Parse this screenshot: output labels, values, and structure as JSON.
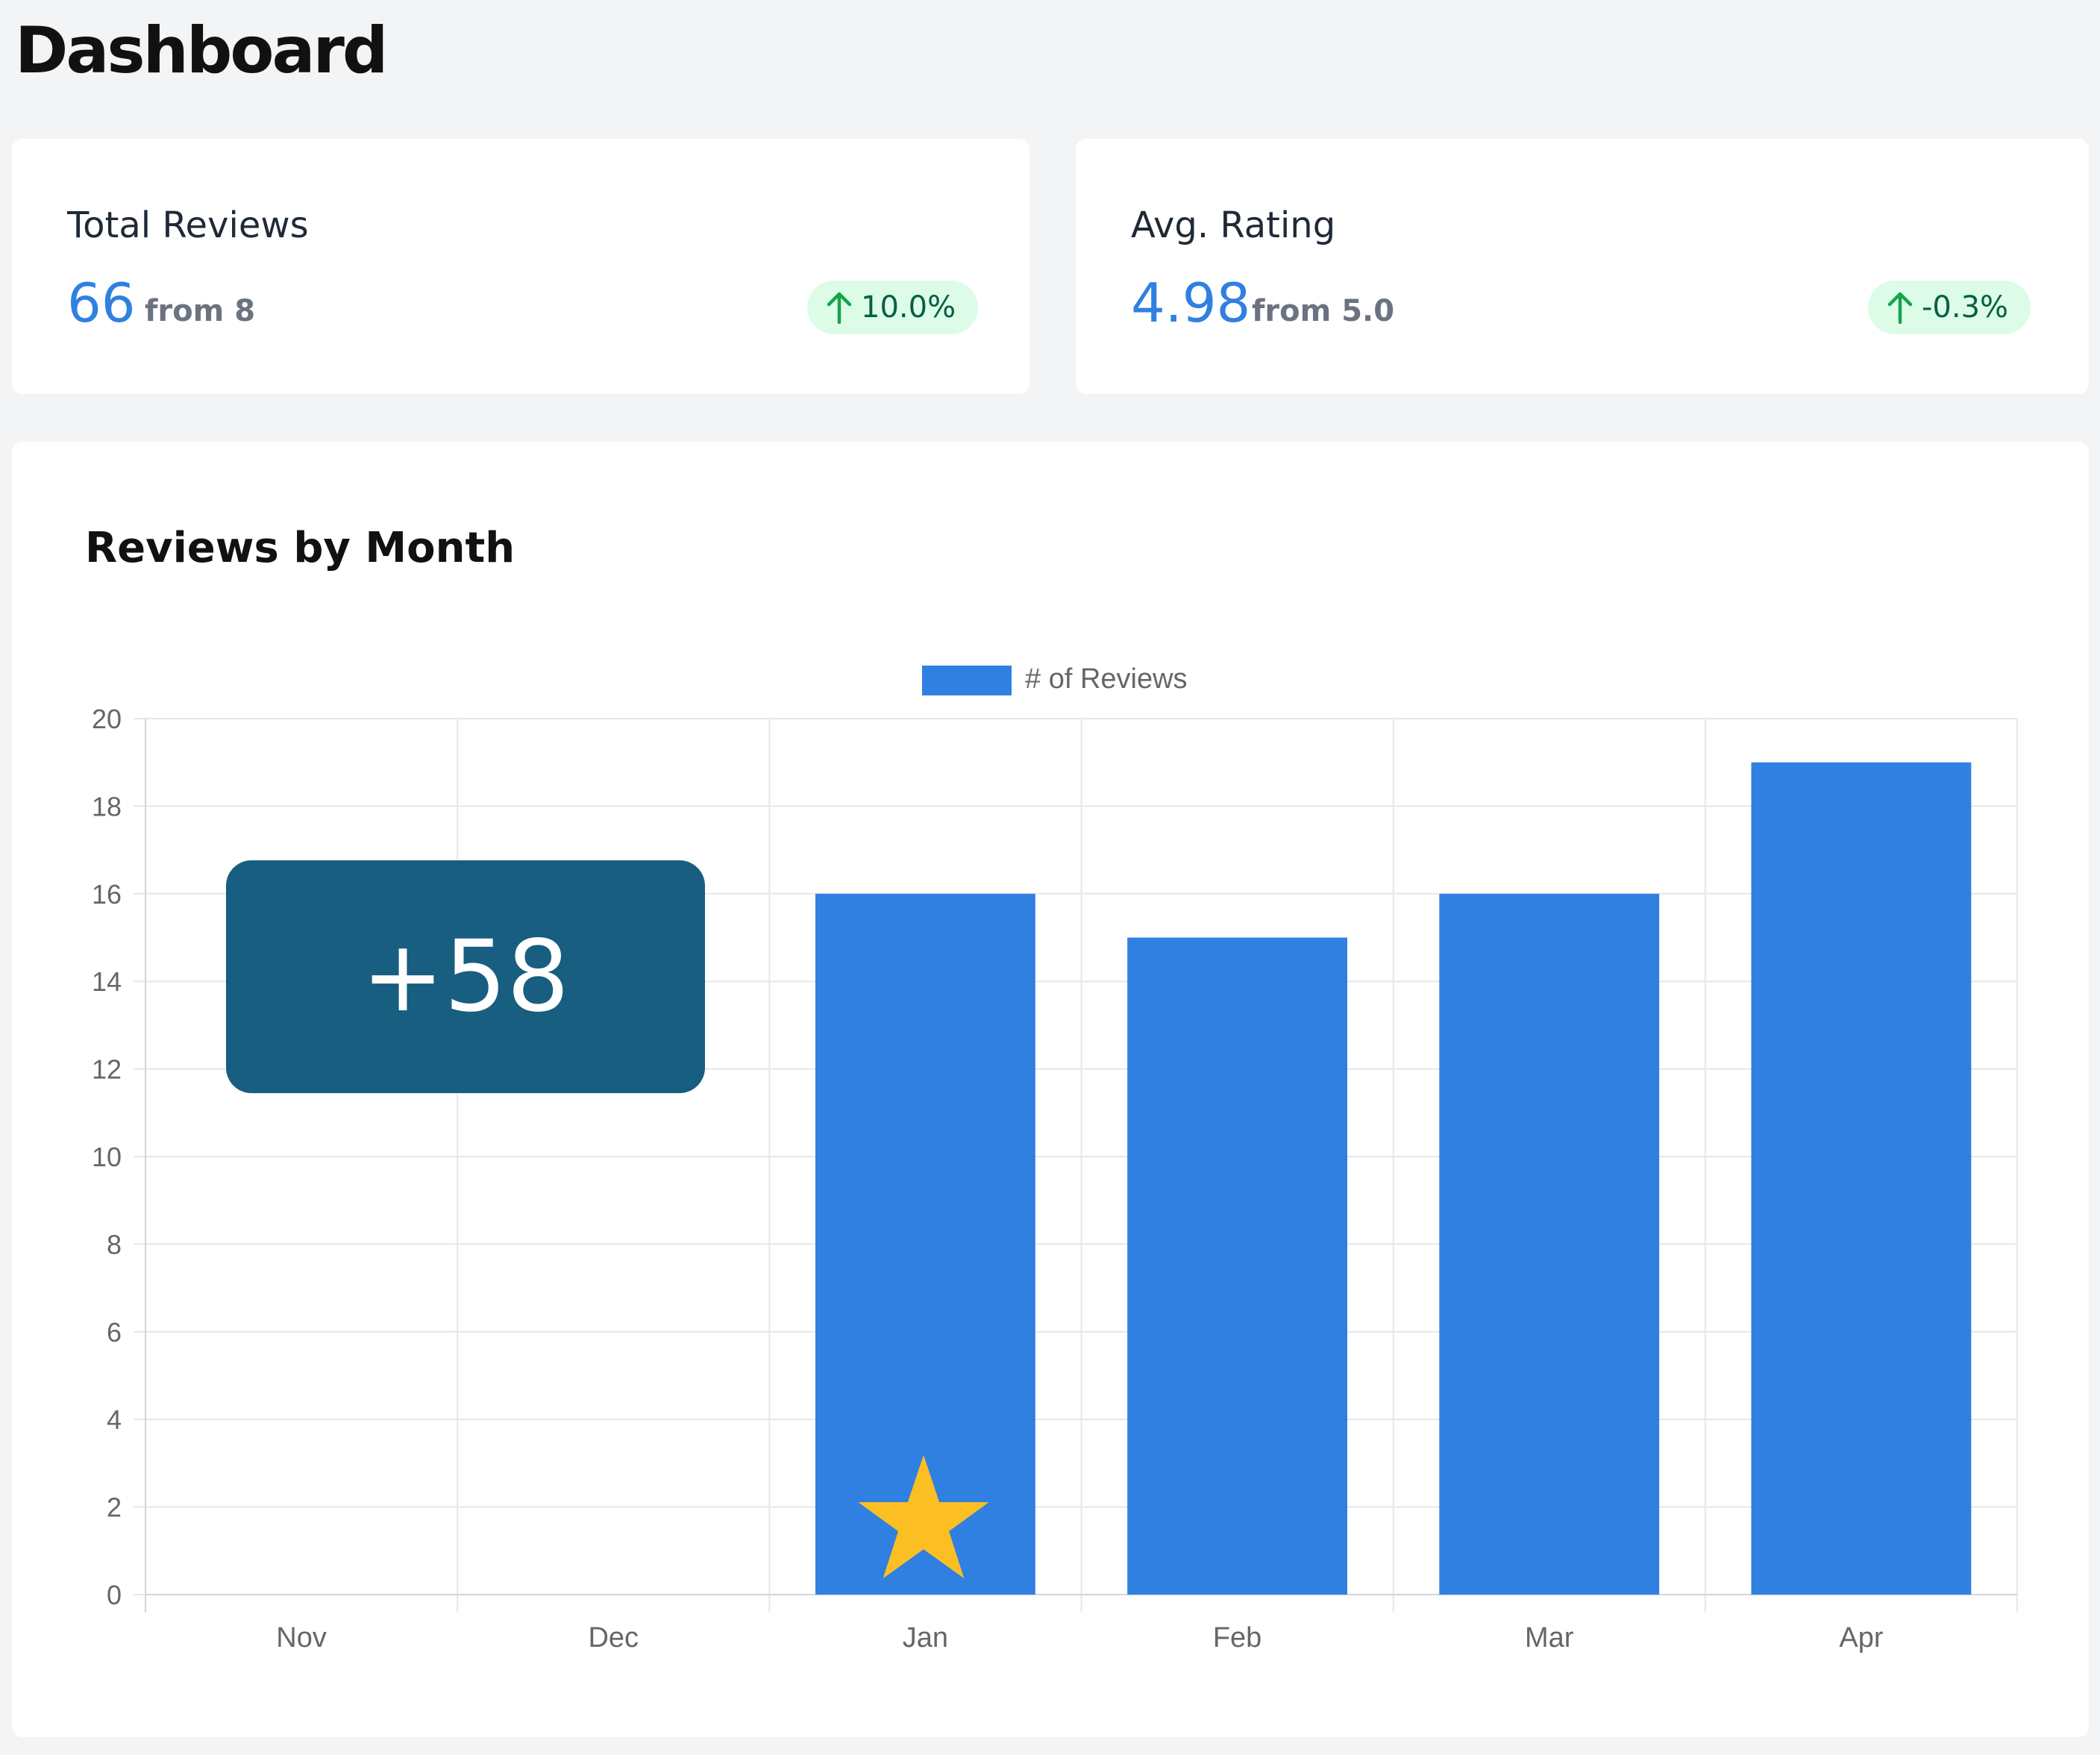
{
  "page": {
    "title": "Dashboard"
  },
  "stats": [
    {
      "label": "Total Reviews",
      "value": "66",
      "from": "from 8",
      "change": "10.0%",
      "trend": "up"
    },
    {
      "label": "Avg. Rating",
      "value": "4.98",
      "from": "from 5.0",
      "change": "-0.3%",
      "trend": "up"
    }
  ],
  "colors": {
    "accent": "#2f80e0",
    "badge_bg": "#dcfce7",
    "badge_icon": "#16a34a",
    "overlay_bg": "#175e80",
    "star": "#fbbf24"
  },
  "overlay": {
    "text": "+58"
  },
  "marker": {
    "icon": "star-icon",
    "category": "Jan"
  },
  "chart_data": {
    "type": "bar",
    "title": "Reviews by Month",
    "categories": [
      "Nov",
      "Dec",
      "Jan",
      "Feb",
      "Mar",
      "Apr"
    ],
    "series": [
      {
        "name": "# of Reviews",
        "values": [
          0,
          0,
          16,
          15,
          16,
          19
        ],
        "color": "#2f80e0"
      }
    ],
    "ylim": [
      0,
      20
    ],
    "yticks": [
      0,
      2,
      4,
      6,
      8,
      10,
      12,
      14,
      16,
      18,
      20
    ],
    "grid": true,
    "legend": "top-center"
  }
}
